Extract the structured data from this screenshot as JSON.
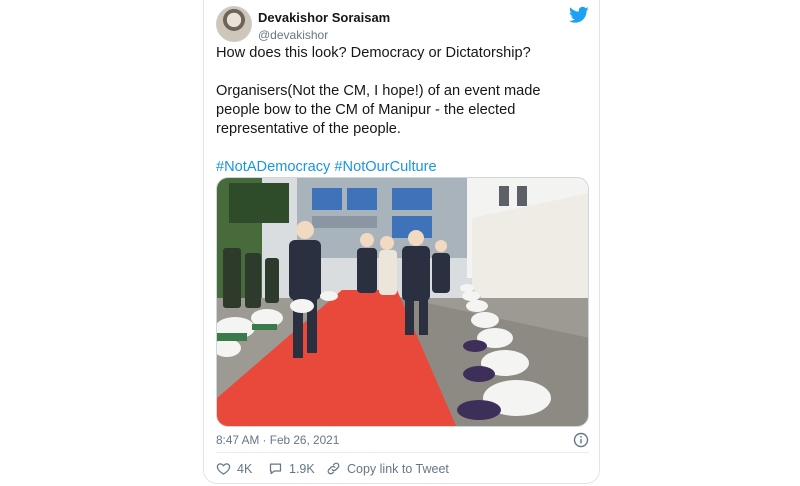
{
  "tweet": {
    "author_name": "Devakishor Soraisam",
    "handle": "@devakishor",
    "line1": "How does this look? Democracy or Dictatorship?",
    "line2": "Organisers(Not the CM, I hope!) of an event made people bow to the CM of Manipur -  the elected representative of the people.",
    "hashtag1": "#NotADemocracy",
    "hashtag2": "#NotOurCulture",
    "timestamp": "8:47 AM · Feb 26, 2021"
  },
  "actions": {
    "likes": "4K",
    "replies": "1.9K",
    "copy_link": "Copy link to Tweet"
  },
  "icons": {
    "logo": "twitter-bird-icon",
    "info": "info-icon",
    "like": "heart-icon",
    "reply": "comment-icon",
    "link": "link-icon"
  },
  "colors": {
    "brand": "#1da1f2",
    "hashtag": "#1b95e0",
    "secondary_text": "#657786",
    "carpet": "#e8493a"
  }
}
